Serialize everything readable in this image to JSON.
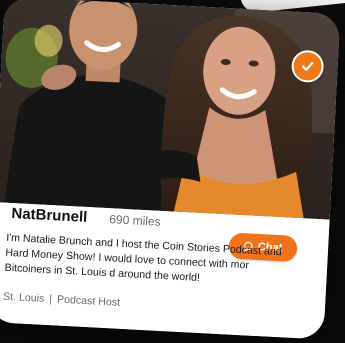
{
  "profile": {
    "name": "NatBrunell",
    "distance": "690 miles",
    "bio_lines": [
      "I'm Natalie Brunch and I host the Coin Stories Podcast and",
      "Hard Money Show! I would love to connect with mor",
      "Bitcoiners in St. Louis d around the world!"
    ],
    "location": "St. Louis",
    "separator": "|",
    "role": "Podcast Host",
    "verified_icon": "checkmark-badge-icon"
  },
  "chat_button": {
    "label": "Chat",
    "icon": "chat-bubble-icon"
  },
  "colors": {
    "accent": "#f0731c",
    "background": "#0b0b0c",
    "card": "#ffffff"
  }
}
